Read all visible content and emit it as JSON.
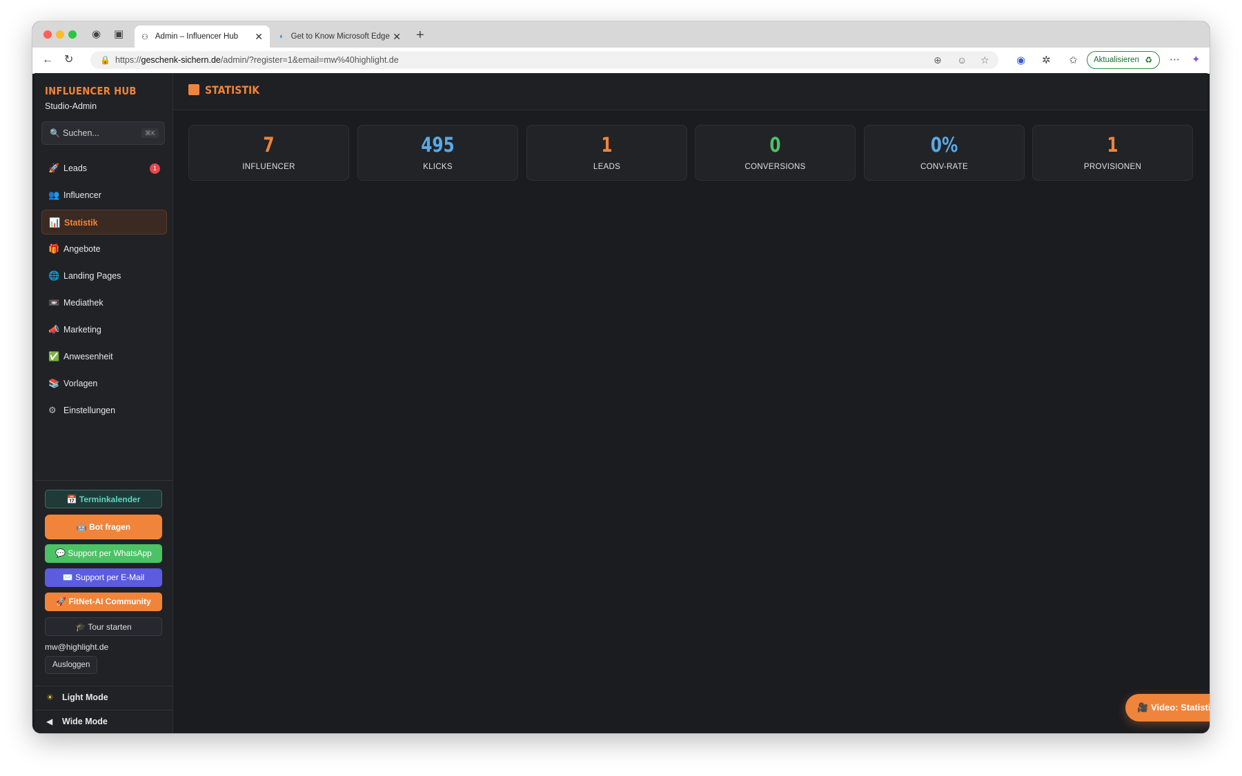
{
  "browser": {
    "tabs": [
      {
        "title": "Admin – Influencer Hub",
        "icon": "admin-icon",
        "active": true
      },
      {
        "title": "Get to Know Microsoft Edge",
        "icon": "edge-icon",
        "active": false
      }
    ],
    "url_prefix": "https://",
    "url_host": "geschenk-sichern.de",
    "url_path": "/admin/?register=1&email=mw%40highlight.de",
    "update_label": "Aktualisieren"
  },
  "sidebar": {
    "brand": "INFLUENCER HUB",
    "subtitle": "Studio-Admin",
    "search_placeholder": "Suchen...",
    "search_shortcut": "⌘K",
    "items": [
      {
        "label": "Leads",
        "icon": "rocket-icon",
        "glyph": "🚀",
        "badge": "1"
      },
      {
        "label": "Influencer",
        "icon": "users-icon",
        "glyph": "👥"
      },
      {
        "label": "Statistik",
        "icon": "bar-chart-icon",
        "glyph": "📊",
        "active": true
      },
      {
        "label": "Angebote",
        "icon": "gift-icon",
        "glyph": "🎁"
      },
      {
        "label": "Landing Pages",
        "icon": "globe-icon",
        "glyph": "🌐"
      },
      {
        "label": "Mediathek",
        "icon": "media-icon",
        "glyph": "📼"
      },
      {
        "label": "Marketing",
        "icon": "megaphone-icon",
        "glyph": "📣"
      },
      {
        "label": "Anwesenheit",
        "icon": "check-icon",
        "glyph": "✅"
      },
      {
        "label": "Vorlagen",
        "icon": "books-icon",
        "glyph": "📚"
      },
      {
        "label": "Einstellungen",
        "icon": "gear-icon",
        "glyph": "⚙"
      }
    ],
    "buttons": {
      "termin": "📅 Terminkalender",
      "bot": "🤖 Bot fragen",
      "whatsapp": "💬 Support per WhatsApp",
      "email": "✉️ Support per E-Mail",
      "community": "🚀 FitNet-AI Community",
      "tour": "🎓 Tour starten"
    },
    "user_email": "mw@highlight.de",
    "logout_label": "Ausloggen",
    "light_mode": "Light Mode",
    "wide_mode": "Wide Mode"
  },
  "main": {
    "title": "STATISTIK",
    "stats": [
      {
        "value": "7",
        "label": "INFLUENCER",
        "color": "#f0843a"
      },
      {
        "value": "495",
        "label": "KLICKS",
        "color": "#5aa9e6"
      },
      {
        "value": "1",
        "label": "LEADS",
        "color": "#f0843a"
      },
      {
        "value": "0",
        "label": "CONVERSIONS",
        "color": "#4cc265"
      },
      {
        "value": "0%",
        "label": "CONV-RATE",
        "color": "#5aa9e6"
      },
      {
        "value": "1",
        "label": "PROVISIONEN",
        "color": "#f0843a"
      }
    ],
    "video_button": "🎥 Video: Statistik"
  },
  "colors": {
    "accent": "#f0843a",
    "blue": "#5aa9e6",
    "green": "#4cc265",
    "badge": "#e5484d"
  }
}
